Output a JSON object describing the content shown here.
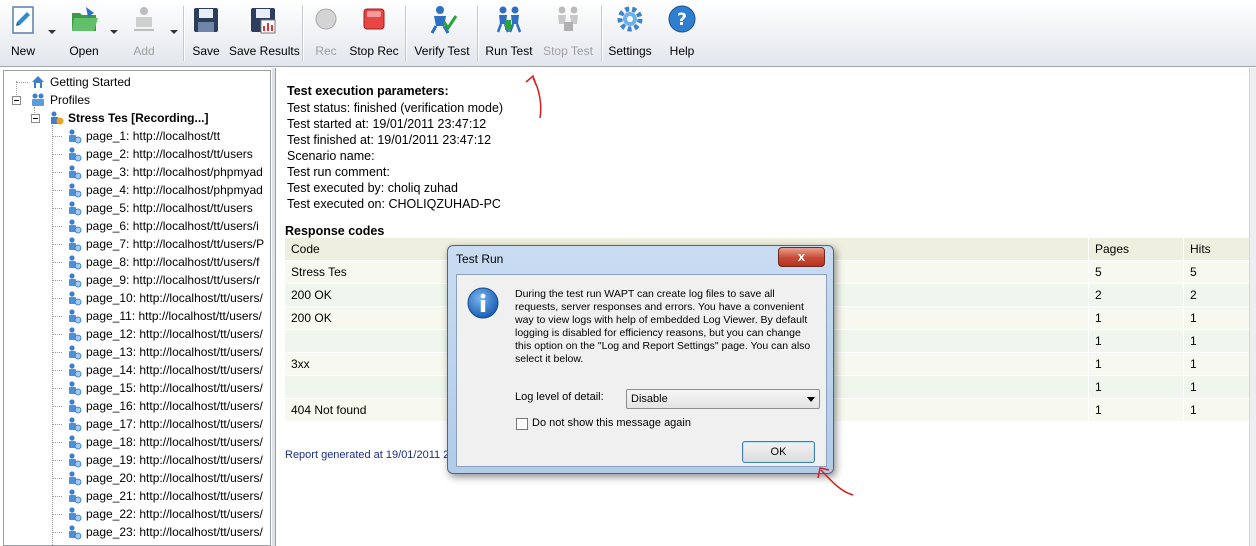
{
  "toolbar": {
    "buttons": [
      {
        "label": "New",
        "icon": "new-document-icon"
      },
      {
        "label": "Open",
        "icon": "open-folder-icon"
      },
      {
        "label": "Add",
        "icon": "add-profile-icon"
      },
      {
        "label": "Save",
        "icon": "save-floppy-icon"
      },
      {
        "label": "Save Results",
        "icon": "save-results-icon"
      },
      {
        "label": "Rec",
        "icon": "record-icon"
      },
      {
        "label": "Stop Rec",
        "icon": "stop-record-icon"
      },
      {
        "label": "Verify Test",
        "icon": "verify-test-icon"
      },
      {
        "label": "Run Test",
        "icon": "run-test-icon"
      },
      {
        "label": "Stop Test",
        "icon": "stop-test-icon"
      },
      {
        "label": "Settings",
        "icon": "gear-icon"
      },
      {
        "label": "Help",
        "icon": "help-icon"
      }
    ]
  },
  "tree": {
    "getting_started": "Getting Started",
    "profiles": "Profiles",
    "scenario": "Stress Tes [Recording...]",
    "pages": [
      "page_1: http://localhost/tt",
      "page_2: http://localhost/tt/users",
      "page_3: http://localhost/phpmyad",
      "page_4: http://localhost/phpmyad",
      "page_5: http://localhost/tt/users",
      "page_6: http://localhost/tt/users/i",
      "page_7: http://localhost/tt/users/P",
      "page_8: http://localhost/tt/users/f",
      "page_9: http://localhost/tt/users/r",
      "page_10: http://localhost/tt/users/",
      "page_11: http://localhost/tt/users/",
      "page_12: http://localhost/tt/users/",
      "page_13: http://localhost/tt/users/",
      "page_14: http://localhost/tt/users/",
      "page_15: http://localhost/tt/users/",
      "page_16: http://localhost/tt/users/",
      "page_17: http://localhost/tt/users/",
      "page_18: http://localhost/tt/users/",
      "page_19: http://localhost/tt/users/",
      "page_20: http://localhost/tt/users/",
      "page_21: http://localhost/tt/users/",
      "page_22: http://localhost/tt/users/",
      "page_23: http://localhost/tt/users/"
    ]
  },
  "report": {
    "params_heading": "Test execution parameters:",
    "lines": [
      "Test status: finished (verification mode)",
      "Test started at: 19/01/2011 23:47:12",
      "Test finished at: 19/01/2011 23:47:12",
      "Scenario name:",
      "Test run comment:",
      "Test executed by: choliq zuhad",
      "Test executed on: CHOLIQZUHAD-PC"
    ],
    "response_heading": "Response codes",
    "table": {
      "headers": [
        "Code",
        "Pages",
        "Hits"
      ],
      "rows": [
        [
          "Stress Tes",
          "5",
          "5"
        ],
        [
          "200 OK",
          "2",
          "2"
        ],
        [
          "200 OK",
          "1",
          "1"
        ],
        [
          "",
          "1",
          "1"
        ],
        [
          "3xx",
          "1",
          "1"
        ],
        [
          "",
          "1",
          "1"
        ],
        [
          "404 Not found",
          "1",
          "1"
        ]
      ]
    },
    "footer": "Report generated at 19/01/2011 2"
  },
  "dialog": {
    "title": "Test Run",
    "close_label": "x",
    "message": "During the test run WAPT can create log files to save all requests, server responses and errors. You have a convenient way to view logs with help of embedded Log Viewer. By default logging is disabled for efficiency reasons, but you can change this option on the \"Log and Report Settings\" page. You can also select it below.",
    "level_label": "Log level of detail:",
    "level_value": "Disable",
    "checkbox_label": "Do not show this message again",
    "ok_label": "OK"
  },
  "colors": {
    "annotation": "#d42020",
    "footer_link": "#1a2f8a",
    "dialog_frame": "#b9d0ec"
  }
}
